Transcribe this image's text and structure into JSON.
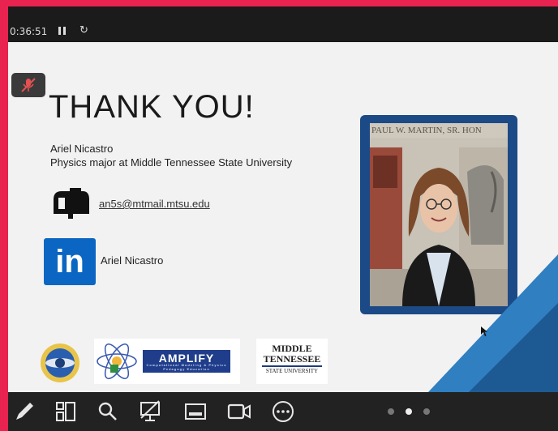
{
  "topbar": {
    "timer": "0:36:51",
    "pause_icon": "pause-icon",
    "refresh_icon": "refresh-icon"
  },
  "slide": {
    "title": "THANK YOU!",
    "name": "Ariel Nicastro",
    "role": "Physics major at Middle Tennessee State University",
    "email": "an5s@mtmail.mtsu.edu",
    "linkedin_logo_text": "in",
    "linkedin_name": "Ariel Nicastro",
    "photo_sign_text": "PAUL W. MARTIN, SR. HON",
    "logos": {
      "amplify_text": "AMPLIFY",
      "amplify_subtitle": "Computational Modeling & Physics Pedagogy Education",
      "mtsu_line1": "MIDDLE",
      "mtsu_line2": "TENNESSEE",
      "mtsu_line3": "STATE UNIVERSITY"
    }
  },
  "toolbar": {
    "icons": [
      "pen-icon",
      "layout-icon",
      "search-icon",
      "screen-share-icon",
      "subtitles-icon",
      "camera-icon",
      "more-icon"
    ],
    "page_dots": 3,
    "active_dot": 2
  },
  "colors": {
    "accent_border": "#e8234f",
    "photo_frame": "#1c4a86",
    "linkedin": "#0a66c2",
    "wedge": "#2f7fc1"
  }
}
